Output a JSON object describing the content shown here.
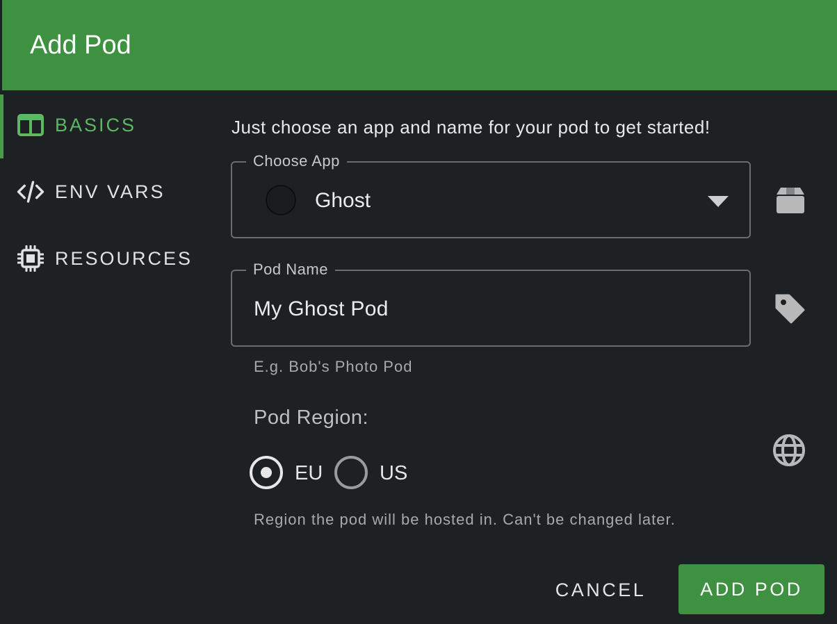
{
  "dialog": {
    "title": "Add Pod"
  },
  "sidebar": {
    "items": [
      {
        "label": "BASICS",
        "icon": "columns-icon",
        "active": true
      },
      {
        "label": "ENV VARS",
        "icon": "code-icon",
        "active": false
      },
      {
        "label": "RESOURCES",
        "icon": "chip-icon",
        "active": false
      }
    ]
  },
  "basics": {
    "intro": "Just choose an app and name for your pod to get started!",
    "app": {
      "legend": "Choose App",
      "value": "Ghost",
      "icon": "box-icon"
    },
    "pod_name": {
      "legend": "Pod Name",
      "value": "My Ghost Pod",
      "hint": "E.g. Bob's Photo Pod",
      "icon": "tag-icon"
    },
    "region": {
      "label": "Pod Region:",
      "options": [
        {
          "label": "EU",
          "checked": true
        },
        {
          "label": "US",
          "checked": false
        }
      ],
      "hint": "Region the pod will be hosted in. Can't be changed later.",
      "icon": "globe-icon"
    }
  },
  "actions": {
    "cancel_label": "CANCEL",
    "submit_label": "ADD POD"
  },
  "colors": {
    "accent": "#3f9142",
    "accent_text": "#5fb663",
    "background": "#1d2124"
  }
}
